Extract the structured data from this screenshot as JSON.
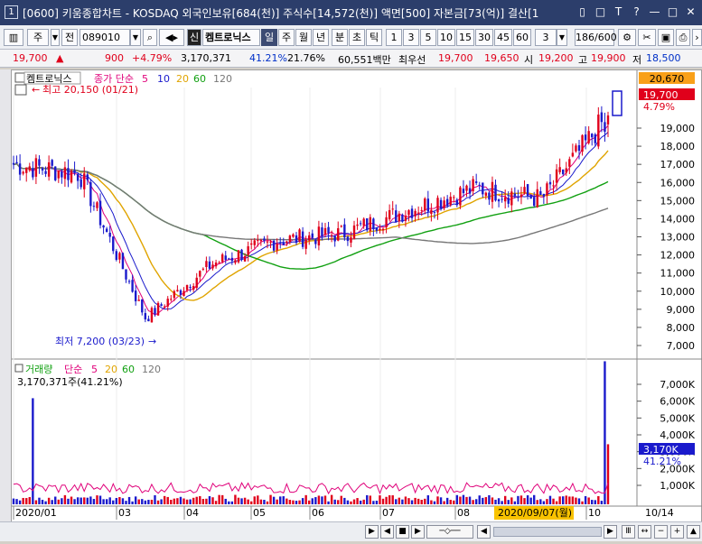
{
  "window": {
    "badge": "1",
    "title": "[0600] 키움종합차트 - KOSDAQ 외국인보유[684(천)] 주식수[14,572(천)] 액면[500] 자본금[73(억)] 결산[1",
    "controls": [
      "▯",
      "□",
      "T",
      "?",
      "—",
      "□",
      "✕"
    ]
  },
  "toolbar": {
    "market_type": "주",
    "prev_label": "전",
    "code": "089010",
    "sin_label": "신",
    "stock_name": "켐트로닉스",
    "periods": [
      "일",
      "주",
      "월",
      "년",
      "분",
      "초",
      "틱"
    ],
    "selected_period": "일",
    "intervals": [
      "1",
      "3",
      "5",
      "10",
      "15",
      "30",
      "45",
      "60"
    ],
    "interval_select": "3",
    "count": "186/600"
  },
  "quote": {
    "price": "19,700",
    "change": "900",
    "change_pct": "+4.79%",
    "volume": "3,170,371",
    "volume_ratio": "41.21%",
    "turnover": "21.76%",
    "trade_amount": "60,551백만",
    "priority_label": "최우선",
    "ask": "19,700",
    "bid": "19,650",
    "open_label": "시",
    "open": "19,200",
    "high_label": "고",
    "high": "19,900",
    "low_label": "저",
    "low": "18,500"
  },
  "chart": {
    "legend_name": "켐트로닉스",
    "legend_type": "종가 단순",
    "ma_periods": [
      "5",
      "10",
      "20",
      "60",
      "120"
    ],
    "ma_colors": [
      "#e0007a",
      "#1a1acc",
      "#e0a400",
      "#11a011",
      "#777777"
    ],
    "up_color": "#e0001b",
    "down_color": "#1a1acc",
    "high_note": "최고 20,150 (01/21)",
    "low_note": "최저 7,200 (03/23)",
    "price_axis": [
      "19,000",
      "18,000",
      "17,000",
      "16,000",
      "15,000",
      "14,000",
      "13,000",
      "12,000",
      "11,000",
      "10,000",
      "9,000",
      "8,000",
      "7,000"
    ],
    "price_top_badge": "20,670",
    "price_current_badge": "19,700",
    "price_current_pct": "4.79%",
    "volume_legend_name": "거래량",
    "volume_legend_type": "단순",
    "volume_ma_periods": [
      "5",
      "20",
      "60",
      "120"
    ],
    "volume_ma_colors": [
      "#e0007a",
      "#e0a400",
      "#11a011",
      "#777777"
    ],
    "volume_value": "3,170,371주(41.21%)",
    "volume_axis": [
      "7,000K",
      "6,000K",
      "5,000K",
      "4,000K",
      "3,000K",
      "2,000K",
      "1,000K"
    ],
    "volume_current_badge": "3,170K",
    "volume_current_pct": "41.21%",
    "x_labels": [
      "2020/01",
      "03",
      "04",
      "05",
      "06",
      "07",
      "08",
      "10"
    ],
    "cursor_date": "2020/09/07(월)",
    "right_date": "10/14"
  },
  "chart_data": {
    "type": "candlestick",
    "title": "켐트로닉스",
    "x_range": [
      "2020/01",
      "2020/10/14"
    ],
    "ylim": [
      6500,
      20670
    ],
    "volume_ylim": [
      0,
      8000
    ],
    "annotations": [
      {
        "label": "최고",
        "value": 20150,
        "date": "01/21"
      },
      {
        "label": "최저",
        "value": 7200,
        "date": "03/23"
      }
    ],
    "close_path_monthly": [
      {
        "period": "2020/01",
        "close": 17000
      },
      {
        "period": "2020/02",
        "close": 16500
      },
      {
        "period": "2020/03",
        "close": 8500
      },
      {
        "period": "2020/04",
        "close": 11500
      },
      {
        "period": "2020/05",
        "close": 12800
      },
      {
        "period": "2020/06",
        "close": 13200
      },
      {
        "period": "2020/07",
        "close": 14500
      },
      {
        "period": "2020/08",
        "close": 15700
      },
      {
        "period": "2020/09",
        "close": 15100
      },
      {
        "period": "2020/10",
        "close": 19700
      }
    ],
    "last": {
      "open": 19200,
      "high": 19900,
      "low": 18500,
      "close": 19700,
      "volume_k": 3170
    },
    "peak_volume_k": 7550
  }
}
